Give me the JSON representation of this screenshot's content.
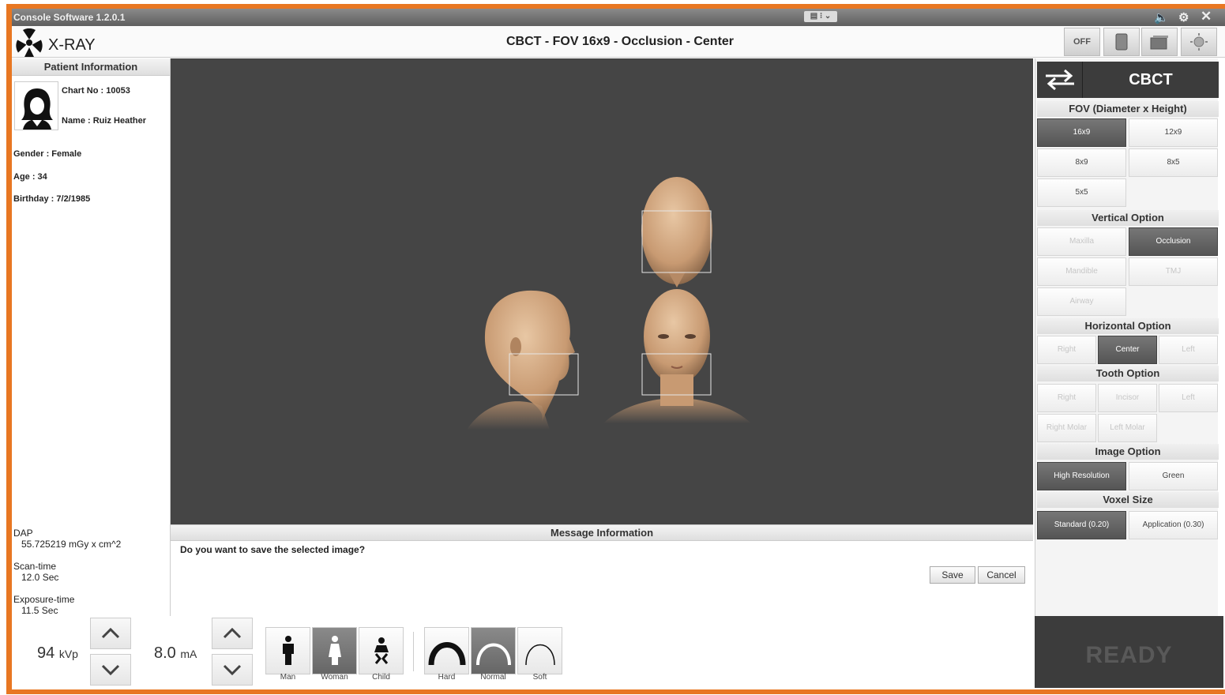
{
  "window": {
    "title": "Console Software  1.2.0.1"
  },
  "header": {
    "app_name": "X-RAY",
    "scan_title": "CBCT - FOV 16x9 - Occlusion - Center",
    "off_label": "OFF"
  },
  "patient": {
    "section_title": "Patient Information",
    "chart_no": "Chart No : 10053",
    "name": "Name : Ruiz Heather",
    "gender": "Gender : Female",
    "age": "Age : 34",
    "birthday": "Birthday : 7/2/1985"
  },
  "stats": {
    "dap_label": "DAP",
    "dap_value": "55.725219 mGy x cm^2",
    "scan_time_label": "Scan-time",
    "scan_time_value": "12.0 Sec",
    "exposure_time_label": "Exposure-time",
    "exposure_time_value": "11.5 Sec"
  },
  "message": {
    "section_title": "Message Information",
    "text": "Do you want to save the selected image?",
    "save_label": "Save",
    "cancel_label": "Cancel"
  },
  "right_panel": {
    "mode": "CBCT",
    "fov_title": "FOV (Diameter x Height)",
    "fov_options": [
      "16x9",
      "12x9",
      "8x9",
      "8x5",
      "5x5"
    ],
    "fov_selected": "16x9",
    "vertical_title": "Vertical Option",
    "vertical_options": [
      "Maxilla",
      "Occlusion",
      "Mandible",
      "TMJ",
      "Airway"
    ],
    "vertical_selected": "Occlusion",
    "horizontal_title": "Horizontal Option",
    "horizontal_options": [
      "Right",
      "Center",
      "Left"
    ],
    "horizontal_selected": "Center",
    "tooth_title": "Tooth Option",
    "tooth_options": [
      "Right",
      "Incisor",
      "Left",
      "Right Molar",
      "Left Molar"
    ],
    "image_title": "Image Option",
    "image_options": [
      "High Resolution",
      "Green"
    ],
    "image_selected": "High Resolution",
    "voxel_title": "Voxel Size",
    "voxel_options": [
      "Standard  (0.20)",
      "Application (0.30)"
    ],
    "voxel_selected": "Standard  (0.20)"
  },
  "controls": {
    "kvp_value": "94",
    "kvp_unit": "kVp",
    "ma_value": "8.0",
    "ma_unit": "mA",
    "patient_types": [
      "Man",
      "Woman",
      "Child"
    ],
    "patient_type_selected": "Woman",
    "bone_types": [
      "Hard",
      "Normal",
      "Soft"
    ],
    "bone_type_selected": "Normal"
  },
  "status": {
    "ready_label": "READY"
  },
  "colors": {
    "frame_border": "#e87722",
    "viewport_bg": "#454545",
    "selected_button": "#5e5e5e"
  }
}
